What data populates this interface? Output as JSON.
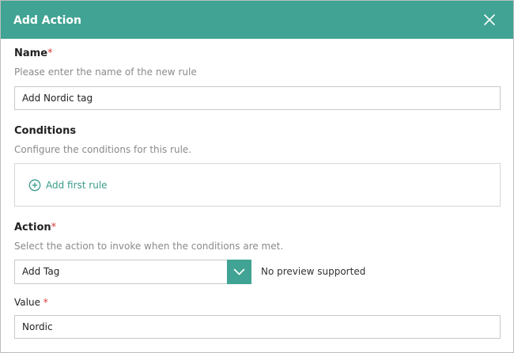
{
  "dialog": {
    "title": "Add Action"
  },
  "colors": {
    "accent": "#40a393",
    "required": "#d83b3b",
    "link": "#3a9a8a"
  },
  "name_field": {
    "label": "Name",
    "required_mark": "*",
    "hint": "Please enter the name of the new rule",
    "value": "Add Nordic tag"
  },
  "conditions": {
    "label": "Conditions",
    "hint": "Configure the conditions for this rule.",
    "add_rule_label": "Add first rule",
    "add_rule_icon": "plus-circle-icon"
  },
  "action_field": {
    "label": "Action",
    "required_mark": "*",
    "hint": "Select the action to invoke when the conditions are met.",
    "selected": "Add Tag",
    "dropdown_icon": "chevron-down-icon",
    "preview_text": "No preview supported"
  },
  "value_field": {
    "label": "Value",
    "required_mark": "*",
    "value": "Nordic"
  },
  "icons": {
    "close": "close-icon"
  }
}
